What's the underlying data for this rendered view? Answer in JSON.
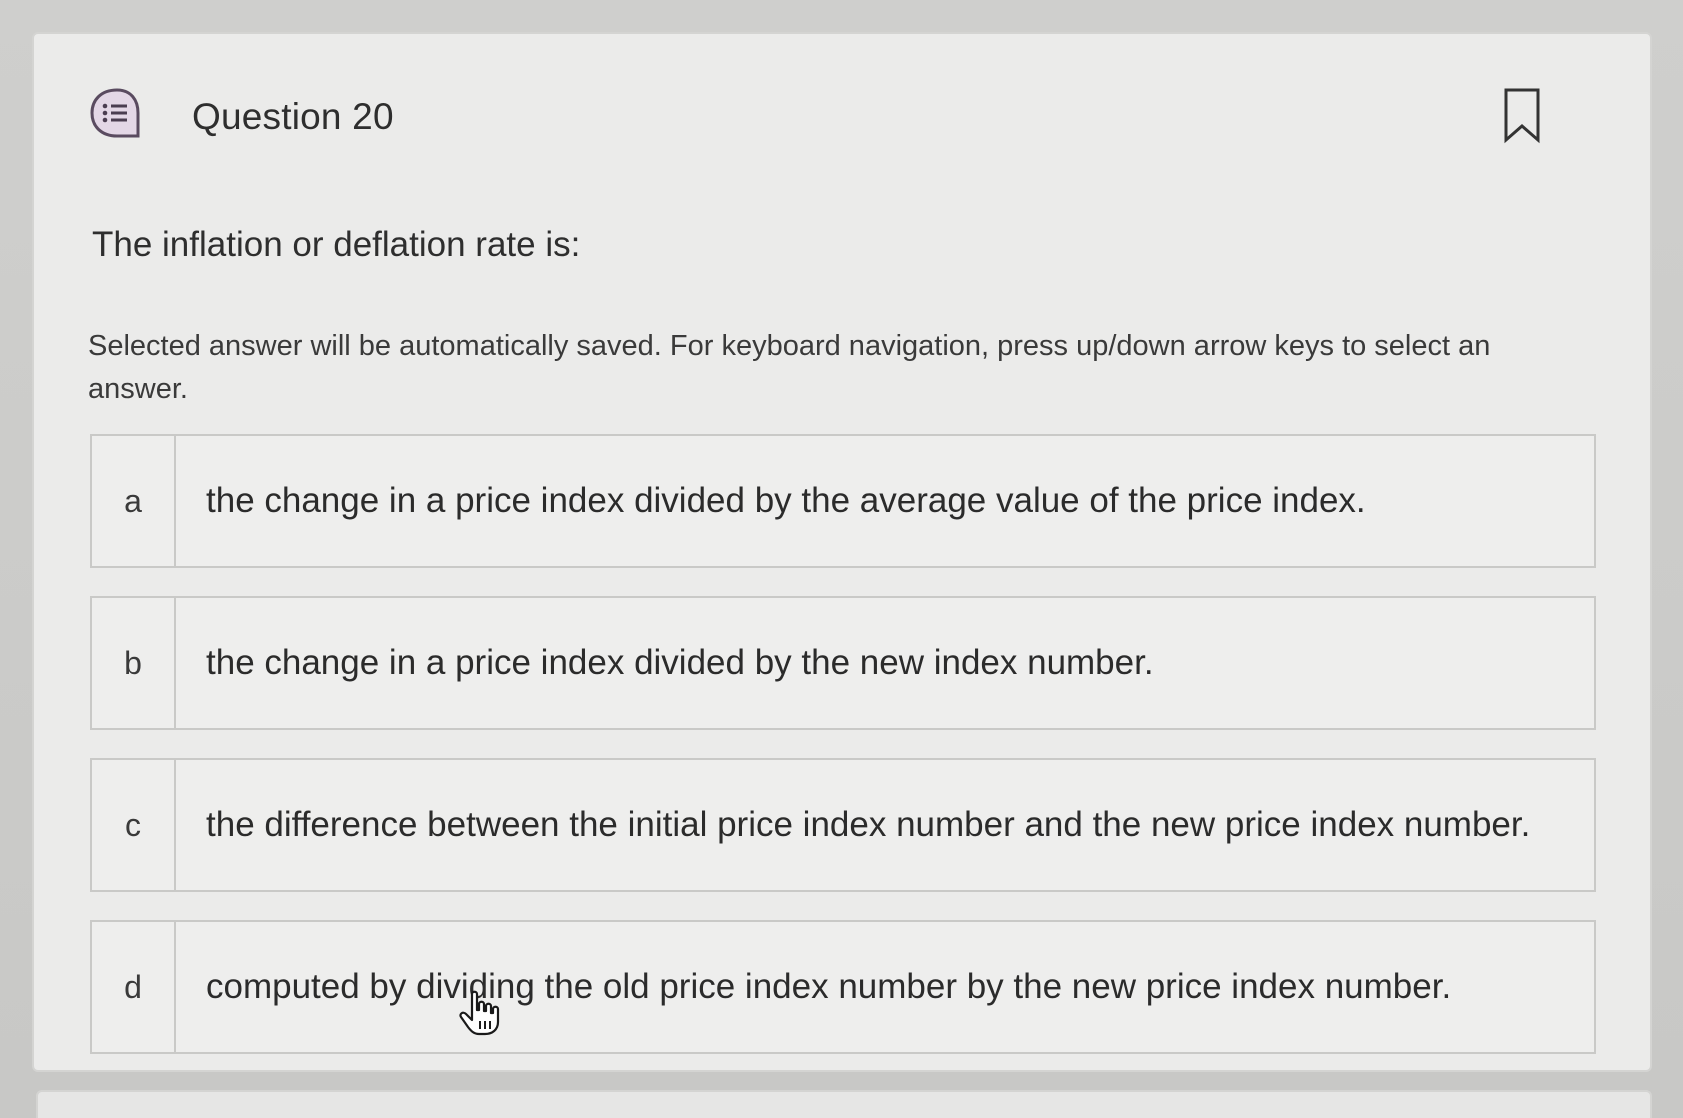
{
  "question": {
    "title": "Question 20",
    "prompt": "The inflation or deflation rate is:",
    "instructions": "Selected answer will be automatically saved. For keyboard navigation, press up/down arrow keys to select an answer."
  },
  "icons": {
    "question_icon": "question-list-icon",
    "bookmark": "bookmark-icon",
    "cursor": "hand-pointer-cursor"
  },
  "options": [
    {
      "letter": "a",
      "text": "the change in a price index divided by the average value of the price index."
    },
    {
      "letter": "b",
      "text": "the change in a price index divided by the new index number."
    },
    {
      "letter": "c",
      "text": "the difference between the initial price index number and the new price index number."
    },
    {
      "letter": "d",
      "text": "computed by dividing the old price index number by the new price index number."
    }
  ],
  "colors": {
    "card_background": "#ebebea",
    "option_border": "#c9c9c7",
    "text": "#2b2b2b"
  }
}
